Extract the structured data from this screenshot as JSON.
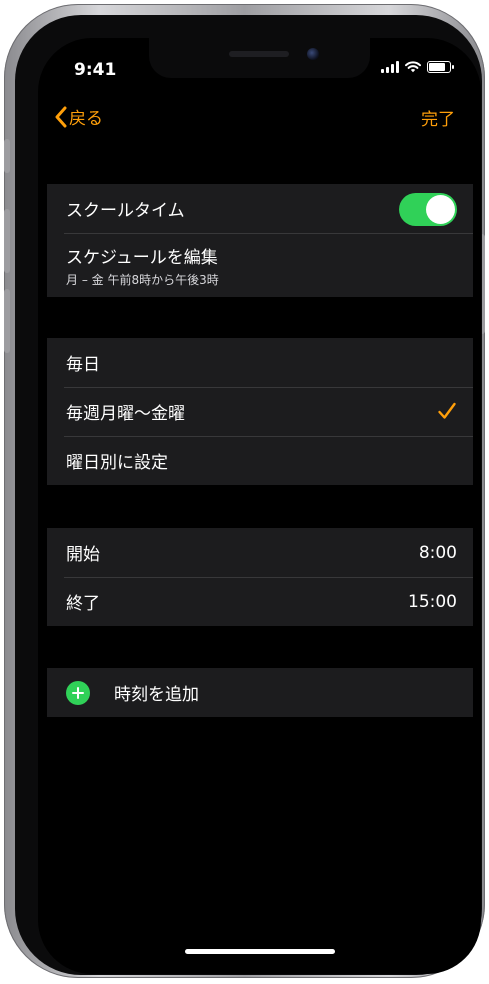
{
  "status_bar": {
    "time": "9:41",
    "battery_level": 0.95
  },
  "nav": {
    "back_label": "戻る",
    "done_label": "完了"
  },
  "schooltime": {
    "title": "スクールタイム",
    "toggle_on": true,
    "edit_schedule_label": "スケジュールを編集",
    "schedule_summary": "月 – 金 午前8時から午後3時"
  },
  "repeat": {
    "options": [
      {
        "label": "毎日",
        "selected": false
      },
      {
        "label": "毎週月曜〜金曜",
        "selected": true
      },
      {
        "label": "曜日別に設定",
        "selected": false
      }
    ]
  },
  "times": {
    "start_label": "開始",
    "start_value": "8:00",
    "end_label": "終了",
    "end_value": "15:00"
  },
  "add_time": {
    "label": "時刻を追加"
  },
  "colors": {
    "accent": "#ff9f0a",
    "toggle_on": "#30d158",
    "row_bg": "#1c1c1e",
    "background": "#000000"
  },
  "icons": [
    "chevron-left-icon",
    "checkmark-icon",
    "plus-circle-icon",
    "cellular-signal-icon",
    "wifi-icon",
    "battery-icon"
  ]
}
